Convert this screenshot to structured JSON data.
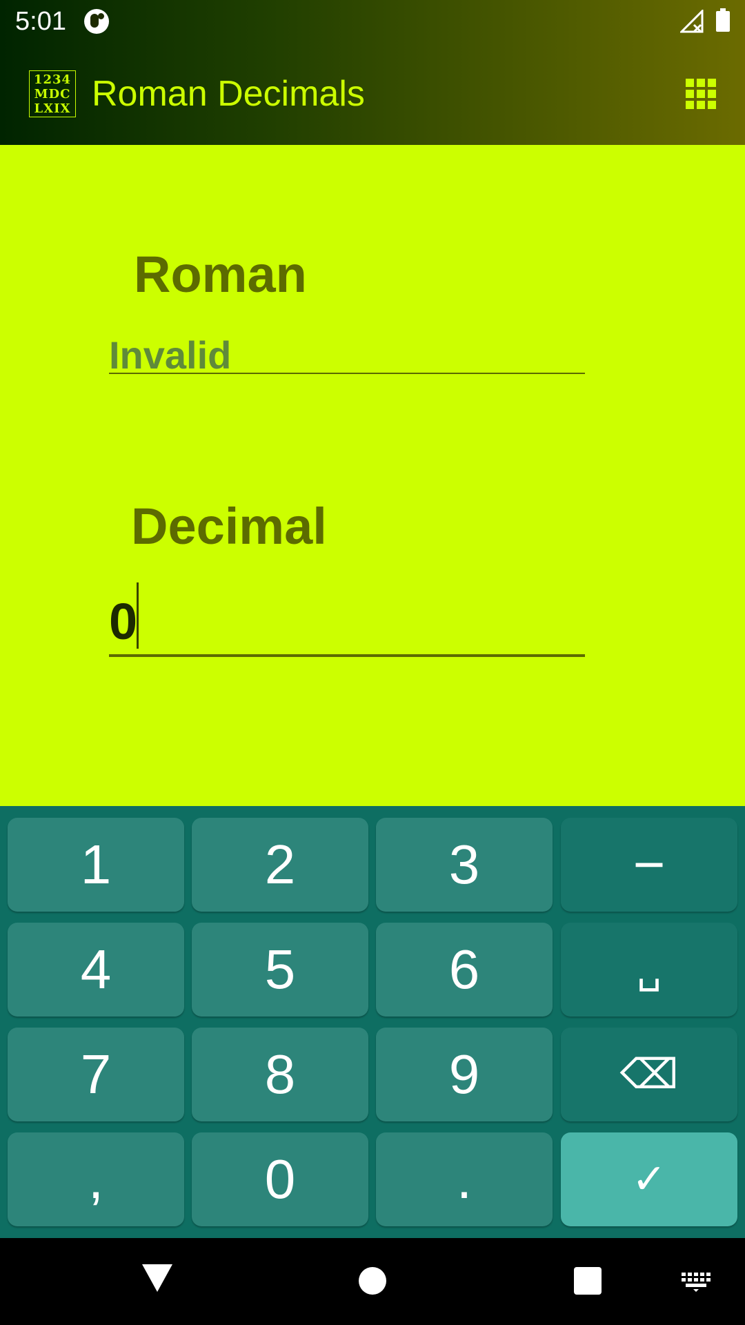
{
  "status_bar": {
    "time": "5:01"
  },
  "app_bar": {
    "logo_lines": [
      "1234",
      "MDC",
      "LXIX"
    ],
    "title": "Roman Decimals"
  },
  "form": {
    "roman_label": "Roman",
    "roman_value": "Invalid",
    "decimal_label": "Decimal",
    "decimal_value": "0"
  },
  "keyboard": {
    "keys": [
      "1",
      "2",
      "3",
      "−",
      "4",
      "5",
      "6",
      "␣",
      "7",
      "8",
      "9",
      "⌫",
      ",",
      "0",
      ".",
      "✓"
    ]
  },
  "colors": {
    "accent": "#ccff00",
    "label": "#5c6b00",
    "keyboard_bg": "#0e6e62",
    "key_bg": "#2d857a",
    "enter_key_bg": "#4ab6a9"
  },
  "icons": {
    "menu": "grid-icon",
    "nav": [
      "back-icon",
      "home-icon",
      "recent-apps-icon",
      "keyboard-icon"
    ]
  }
}
